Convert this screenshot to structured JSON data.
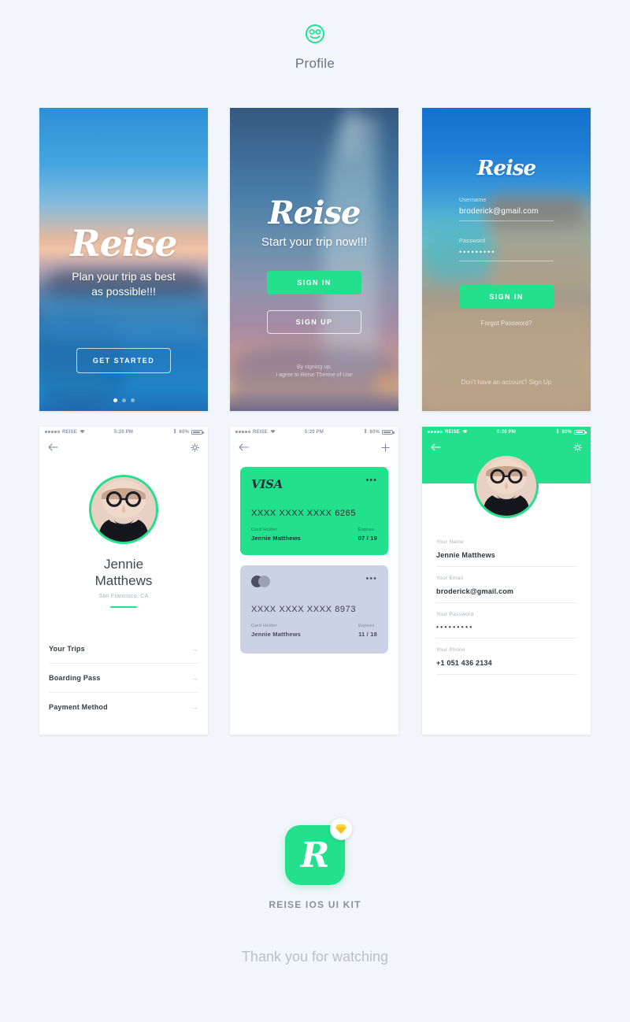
{
  "header": {
    "icon": "smiley-face-icon",
    "title": "Profile"
  },
  "colors": {
    "accent_green": "#22e08c",
    "page_background": "#f2f5f9",
    "card_gray": "#ccd2e6",
    "muted_text": "#a9afbd"
  },
  "screens": {
    "onboarding": {
      "logo": "Reise",
      "tagline_line1": "Plan your trip as best",
      "tagline_line2": "as possible!!!",
      "cta": "GET STARTED",
      "dots": 3,
      "active_dot": 1
    },
    "welcome": {
      "logo": "Reise",
      "tagline": "Start your trip now!!!",
      "sign_in": "SIGN IN",
      "sign_up": "SIGN UP",
      "legal_line1": "By signing up,",
      "legal_line2": "I agree to Reise Therme of Use"
    },
    "login": {
      "logo": "Reise",
      "username_label": "Username",
      "username_value": "broderick@gmail.com",
      "password_label": "Password",
      "password_value": "•••••••••",
      "sign_in": "SIGN IN",
      "forgot": "Forgot Password?",
      "no_account": "Don't have an account? Sign Up"
    },
    "profile": {
      "statusbar": {
        "carrier": "REISE",
        "time": "5:20 PM",
        "battery": "80%"
      },
      "back_icon": "back-arrow-icon",
      "settings_icon": "gear-icon",
      "name_line1": "Jennie",
      "name_line2": "Matthews",
      "location": "San Francisco, CA",
      "menu": [
        {
          "label": "Your Trips"
        },
        {
          "label": "Boarding Pass"
        },
        {
          "label": "Payment Method"
        }
      ],
      "menu_arrow": "→"
    },
    "payment": {
      "statusbar": {
        "carrier": "REISE",
        "time": "5:20 PM",
        "battery": "80%"
      },
      "back_icon": "back-arrow-icon",
      "add_icon": "plus-icon",
      "cards": [
        {
          "brand": "VISA",
          "brand_type": "visa",
          "number": "XXXX  XXXX  XXXX  6265",
          "holder_label": "Card Holder",
          "holder_value": "Jennie Matthews",
          "expires_label": "Expires",
          "expires_value": "07 / 19",
          "more_icon": "more-dots-icon"
        },
        {
          "brand": "",
          "brand_type": "mastercard",
          "number": "XXXX  XXXX  XXXX  8973",
          "holder_label": "Card Holder",
          "holder_value": "Jennie Matthews",
          "expires_label": "Expires",
          "expires_value": "11 / 18",
          "more_icon": "more-dots-icon"
        }
      ]
    },
    "edit_profile": {
      "statusbar": {
        "carrier": "REISE",
        "time": "5:20 PM",
        "battery": "80%"
      },
      "back_icon": "back-arrow-icon",
      "settings_icon": "gear-icon",
      "fields": [
        {
          "label": "Your Name",
          "value": "Jennie Matthews",
          "masked": false
        },
        {
          "label": "Your Email",
          "value": "broderick@gmail.com",
          "masked": false
        },
        {
          "label": "Your Password",
          "value": "•••••••••",
          "masked": true
        },
        {
          "label": "Your Phone",
          "value": "+1 051 436 2134",
          "masked": false
        }
      ]
    }
  },
  "footer": {
    "app_letter": "R",
    "badge_icon": "sketch-diamond-icon",
    "kit_title": "REISE IOS UI KIT",
    "thanks": "Thank you for watching"
  }
}
